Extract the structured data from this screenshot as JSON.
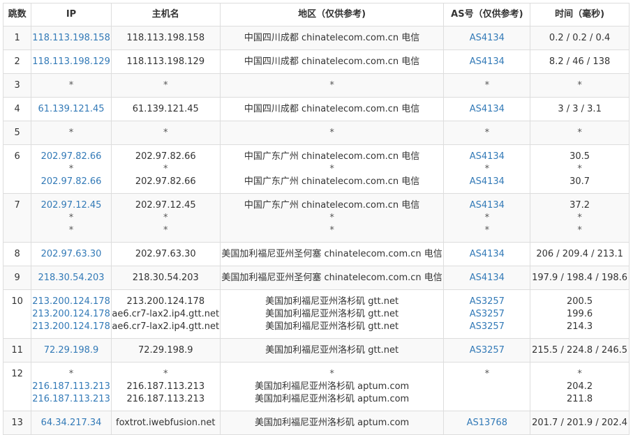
{
  "table": {
    "headers": {
      "hop": "跳数",
      "ip": "IP",
      "host": "主机名",
      "location": "地区（仅供参考)",
      "asn": "AS号（仅供参考)",
      "time": "时间（毫秒)"
    },
    "rows": [
      {
        "hop": "1",
        "ip": [
          "118.113.198.158"
        ],
        "host": [
          "118.113.198.158"
        ],
        "location": [
          "中国四川成都 chinatelecom.com.cn 电信"
        ],
        "asn": [
          "AS4134"
        ],
        "time": [
          "0.2 / 0.2 / 0.4"
        ]
      },
      {
        "hop": "2",
        "ip": [
          "118.113.198.129"
        ],
        "host": [
          "118.113.198.129"
        ],
        "location": [
          "中国四川成都 chinatelecom.com.cn 电信"
        ],
        "asn": [
          "AS4134"
        ],
        "time": [
          "8.2 / 46 / 138"
        ]
      },
      {
        "hop": "3",
        "ip": [
          "*"
        ],
        "host": [
          "*"
        ],
        "location": [
          "*"
        ],
        "asn": [
          "*"
        ],
        "time": [
          "*"
        ]
      },
      {
        "hop": "4",
        "ip": [
          "61.139.121.45"
        ],
        "host": [
          "61.139.121.45"
        ],
        "location": [
          "中国四川成都 chinatelecom.com.cn 电信"
        ],
        "asn": [
          "AS4134"
        ],
        "time": [
          "3 / 3 / 3.1"
        ]
      },
      {
        "hop": "5",
        "ip": [
          "*"
        ],
        "host": [
          "*"
        ],
        "location": [
          "*"
        ],
        "asn": [
          "*"
        ],
        "time": [
          "*"
        ]
      },
      {
        "hop": "6",
        "ip": [
          "202.97.82.66",
          "*",
          "202.97.82.66"
        ],
        "host": [
          "202.97.82.66",
          "*",
          "202.97.82.66"
        ],
        "location": [
          "中国广东广州 chinatelecom.com.cn 电信",
          "*",
          "中国广东广州 chinatelecom.com.cn 电信"
        ],
        "asn": [
          "AS4134",
          "*",
          "AS4134"
        ],
        "time": [
          "30.5",
          "*",
          "30.7"
        ]
      },
      {
        "hop": "7",
        "ip": [
          "202.97.12.45",
          "*",
          "*"
        ],
        "host": [
          "202.97.12.45",
          "*",
          "*"
        ],
        "location": [
          "中国广东广州 chinatelecom.com.cn 电信",
          "*",
          "*"
        ],
        "asn": [
          "AS4134",
          "*",
          "*"
        ],
        "time": [
          "37.2",
          "*",
          "*"
        ]
      },
      {
        "hop": "8",
        "ip": [
          "202.97.63.30"
        ],
        "host": [
          "202.97.63.30"
        ],
        "location": [
          "美国加利福尼亚州圣何塞 chinatelecom.com.cn 电信"
        ],
        "asn": [
          "AS4134"
        ],
        "time": [
          "206 / 209.4 / 213.1"
        ]
      },
      {
        "hop": "9",
        "ip": [
          "218.30.54.203"
        ],
        "host": [
          "218.30.54.203"
        ],
        "location": [
          "美国加利福尼亚州圣何塞 chinatelecom.com.cn 电信"
        ],
        "asn": [
          "AS4134"
        ],
        "time": [
          "197.9 / 198.4 / 198.6"
        ]
      },
      {
        "hop": "10",
        "ip": [
          "213.200.124.178",
          "213.200.124.178",
          "213.200.124.178"
        ],
        "host": [
          "213.200.124.178",
          "ae6.cr7-lax2.ip4.gtt.net",
          "ae6.cr7-lax2.ip4.gtt.net"
        ],
        "location": [
          "美国加利福尼亚州洛杉矶 gtt.net",
          "美国加利福尼亚州洛杉矶 gtt.net",
          "美国加利福尼亚州洛杉矶 gtt.net"
        ],
        "asn": [
          "AS3257",
          "AS3257",
          "AS3257"
        ],
        "time": [
          "200.5",
          "199.6",
          "214.3"
        ]
      },
      {
        "hop": "11",
        "ip": [
          "72.29.198.9"
        ],
        "host": [
          "72.29.198.9"
        ],
        "location": [
          "美国加利福尼亚州洛杉矶 gtt.net"
        ],
        "asn": [
          "AS3257"
        ],
        "time": [
          "215.5 / 224.8 / 246.5"
        ]
      },
      {
        "hop": "12",
        "ip": [
          "*",
          "216.187.113.213",
          "216.187.113.213"
        ],
        "host": [
          "*",
          "216.187.113.213",
          "216.187.113.213"
        ],
        "location": [
          "*",
          "美国加利福尼亚州洛杉矶 aptum.com",
          "美国加利福尼亚州洛杉矶 aptum.com"
        ],
        "asn": [
          "*",
          "",
          ""
        ],
        "time": [
          "*",
          "204.2",
          "211.8"
        ]
      },
      {
        "hop": "13",
        "ip": [
          "64.34.217.34"
        ],
        "host": [
          "foxtrot.iwebfusion.net"
        ],
        "location": [
          "美国加利福尼亚州洛杉矶 aptum.com"
        ],
        "asn": [
          "AS13768"
        ],
        "time": [
          "201.7 / 201.9 / 202.4"
        ]
      }
    ]
  },
  "colors": {
    "link": "#337ab7",
    "text": "#333333",
    "border": "#dddddd",
    "stripe": "#f9f9f9"
  }
}
